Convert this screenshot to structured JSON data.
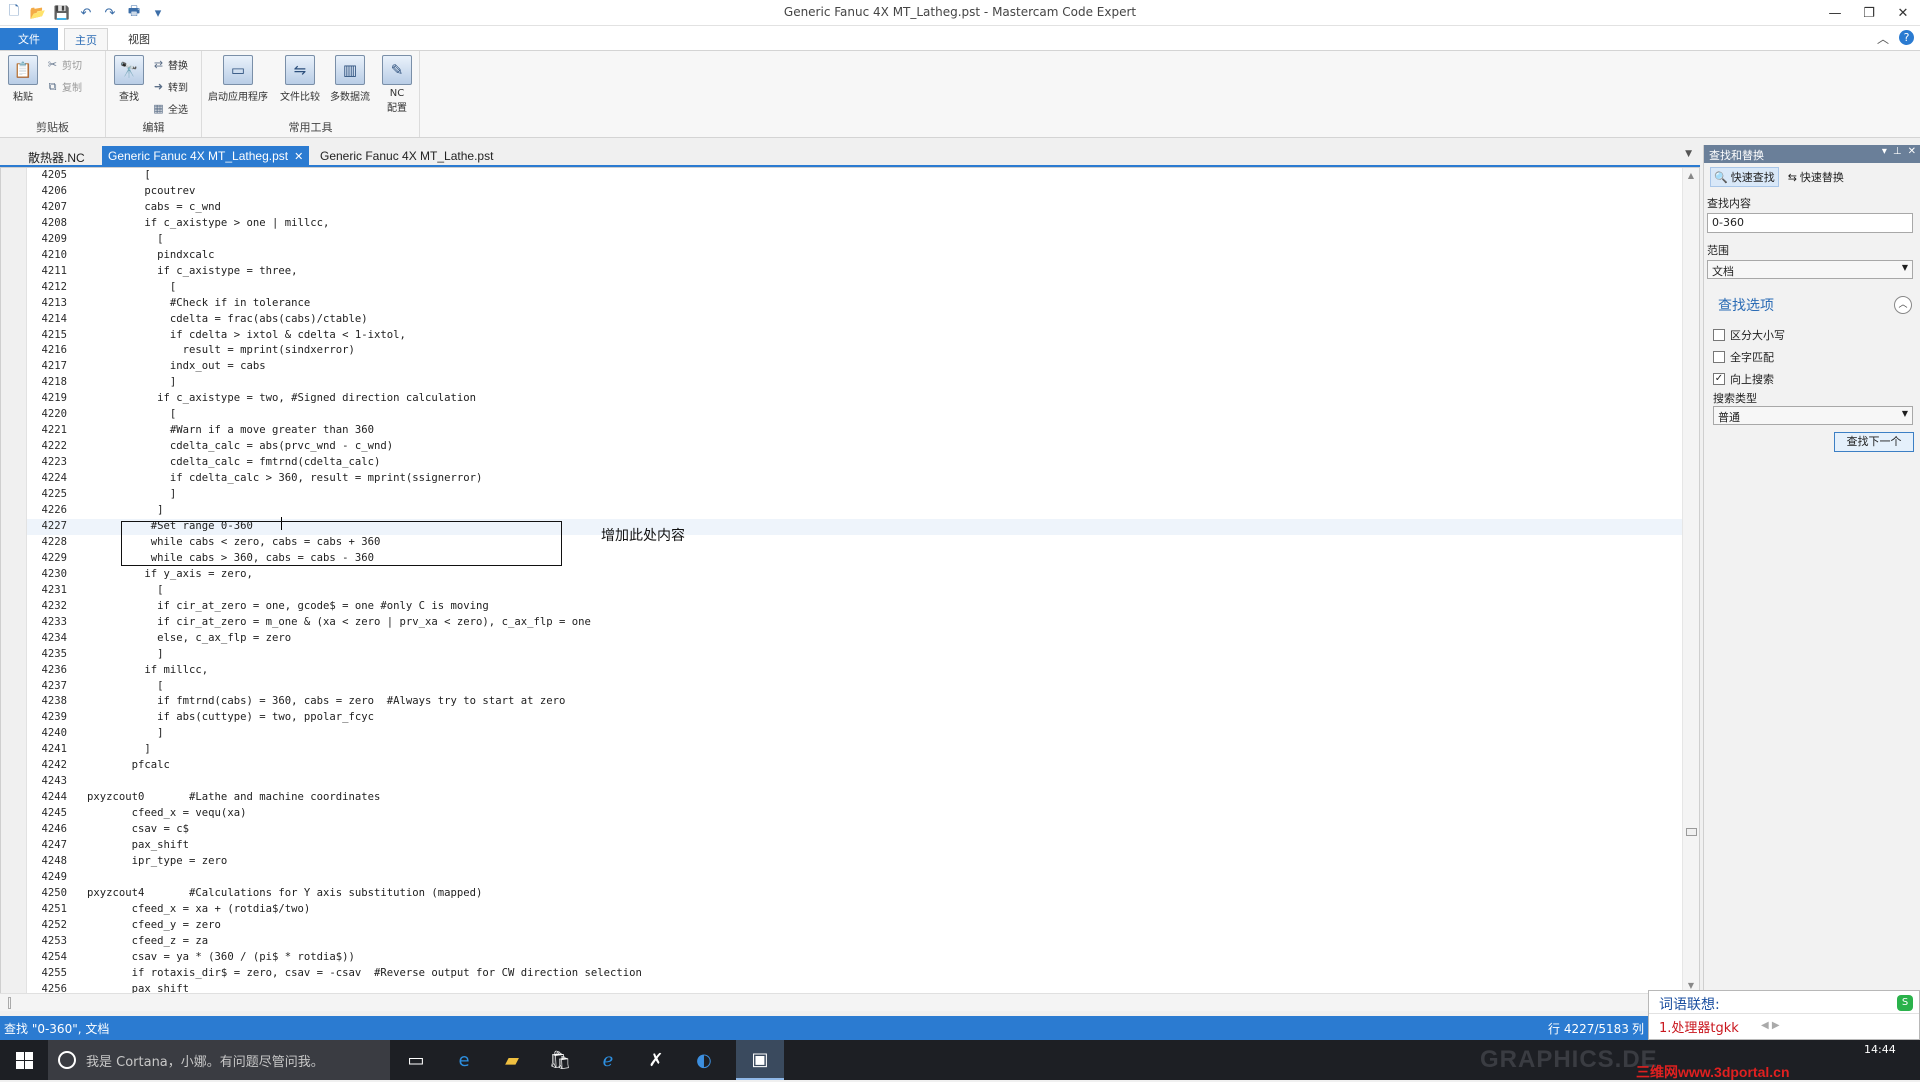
{
  "window": {
    "title": "Generic Fanuc 4X MT_Latheg.pst - Mastercam Code Expert"
  },
  "ribbon": {
    "tabs": [
      "文件",
      "主页",
      "视图"
    ],
    "clipboard": {
      "paste": "粘贴",
      "cut": "剪切",
      "copy": "复制",
      "label": "剪贴板"
    },
    "edit": {
      "find": "查找",
      "replace": "替换",
      "goto": "转到",
      "select_all": "全选",
      "label": "编辑"
    },
    "tools": {
      "launch_app": "启动应用程序",
      "file_compare": "文件比较",
      "multi_stream": "多数据流",
      "nc_config_1": "NC",
      "nc_config_2": "配置",
      "label": "常用工具"
    }
  },
  "doc_tabs": [
    {
      "label": "散热器.NC",
      "active": false
    },
    {
      "label": "Generic Fanuc 4X MT_Latheg.pst",
      "active": true
    },
    {
      "label": "Generic Fanuc 4X MT_Lathe.pst",
      "active": false
    }
  ],
  "editor": {
    "current_line": 4227,
    "lines": [
      {
        "n": "4205",
        "t": "         ["
      },
      {
        "n": "4206",
        "t": "         pcoutrev"
      },
      {
        "n": "4207",
        "t": "         cabs = c_wnd"
      },
      {
        "n": "4208",
        "t": "         if c_axistype > one | millcc,"
      },
      {
        "n": "4209",
        "t": "           ["
      },
      {
        "n": "4210",
        "t": "           pindxcalc"
      },
      {
        "n": "4211",
        "t": "           if c_axistype = three,"
      },
      {
        "n": "4212",
        "t": "             ["
      },
      {
        "n": "4213",
        "t": "             #Check if in tolerance"
      },
      {
        "n": "4214",
        "t": "             cdelta = frac(abs(cabs)/ctable)"
      },
      {
        "n": "4215",
        "t": "             if cdelta > ixtol & cdelta < 1-ixtol,"
      },
      {
        "n": "4216",
        "t": "               result = mprint(sindxerror)"
      },
      {
        "n": "4217",
        "t": "             indx_out = cabs"
      },
      {
        "n": "4218",
        "t": "             ]"
      },
      {
        "n": "4219",
        "t": "           if c_axistype = two, #Signed direction calculation"
      },
      {
        "n": "4220",
        "t": "             ["
      },
      {
        "n": "4221",
        "t": "             #Warn if a move greater than 360"
      },
      {
        "n": "4222",
        "t": "             cdelta_calc = abs(prvc_wnd - c_wnd)"
      },
      {
        "n": "4223",
        "t": "             cdelta_calc = fmtrnd(cdelta_calc)"
      },
      {
        "n": "4224",
        "t": "             if cdelta_calc > 360, result = mprint(ssignerror)"
      },
      {
        "n": "4225",
        "t": "             ]"
      },
      {
        "n": "4226",
        "t": "           ]"
      },
      {
        "n": "4227",
        "t": "          #Set range 0-360"
      },
      {
        "n": "4228",
        "t": "          while cabs < zero, cabs = cabs + 360"
      },
      {
        "n": "4229",
        "t": "          while cabs > 360, cabs = cabs - 360"
      },
      {
        "n": "4230",
        "t": "         if y_axis = zero,"
      },
      {
        "n": "4231",
        "t": "           ["
      },
      {
        "n": "4232",
        "t": "           if cir_at_zero = one, gcode$ = one #only C is moving"
      },
      {
        "n": "4233",
        "t": "           if cir_at_zero = m_one & (xa < zero | prv_xa < zero), c_ax_flp = one"
      },
      {
        "n": "4234",
        "t": "           else, c_ax_flp = zero"
      },
      {
        "n": "4235",
        "t": "           ]"
      },
      {
        "n": "4236",
        "t": "         if millcc,"
      },
      {
        "n": "4237",
        "t": "           ["
      },
      {
        "n": "4238",
        "t": "           if fmtrnd(cabs) = 360, cabs = zero  #Always try to start at zero"
      },
      {
        "n": "4239",
        "t": "           if abs(cuttype) = two, ppolar_fcyc"
      },
      {
        "n": "4240",
        "t": "           ]"
      },
      {
        "n": "4241",
        "t": "         ]"
      },
      {
        "n": "4242",
        "t": "       pfcalc"
      },
      {
        "n": "4243",
        "t": ""
      },
      {
        "n": "4244",
        "t": "pxyzcout0       #Lathe and machine coordinates"
      },
      {
        "n": "4245",
        "t": "       cfeed_x = vequ(xa)"
      },
      {
        "n": "4246",
        "t": "       csav = c$"
      },
      {
        "n": "4247",
        "t": "       pax_shift"
      },
      {
        "n": "4248",
        "t": "       ipr_type = zero"
      },
      {
        "n": "4249",
        "t": ""
      },
      {
        "n": "4250",
        "t": "pxyzcout4       #Calculations for Y axis substitution (mapped)"
      },
      {
        "n": "4251",
        "t": "       cfeed_x = xa + (rotdia$/two)"
      },
      {
        "n": "4252",
        "t": "       cfeed_y = zero"
      },
      {
        "n": "4253",
        "t": "       cfeed_z = za"
      },
      {
        "n": "4254",
        "t": "       csav = ya * (360 / (pi$ * rotdia$))"
      },
      {
        "n": "4255",
        "t": "       if rotaxis_dir$ = zero, csav = -csav  #Reverse output for CW direction selection"
      },
      {
        "n": "4256",
        "t": "       pax_shift"
      }
    ],
    "annotation": "增加此处内容"
  },
  "find_panel": {
    "title": "查找和替换",
    "quick_find": "快速查找",
    "quick_replace": "快速替换",
    "find_label": "查找内容",
    "find_value": "0-360",
    "scope_label": "范围",
    "scope_value": "文档",
    "options_title": "查找选项",
    "match_case": "区分大小写",
    "whole_word": "全字匹配",
    "search_up": "向上搜索",
    "search_type_label": "搜索类型",
    "search_type_value": "普通",
    "find_next": "查找下一个",
    "checks": {
      "match_case": false,
      "whole_word": false,
      "search_up": true
    }
  },
  "ime": {
    "title": "词语联想:",
    "candidate": "1.处理器tgkk"
  },
  "status": {
    "left": "查找 \"0-360\", 文档",
    "position": "行 4227/5183",
    "col": "列"
  },
  "taskbar": {
    "cortana": "我是 Cortana，小娜。有问题尽管问我。",
    "clock": "14:44",
    "watermark": "GRAPHICS.DE",
    "source": "三维网www.3dportal.cn"
  }
}
